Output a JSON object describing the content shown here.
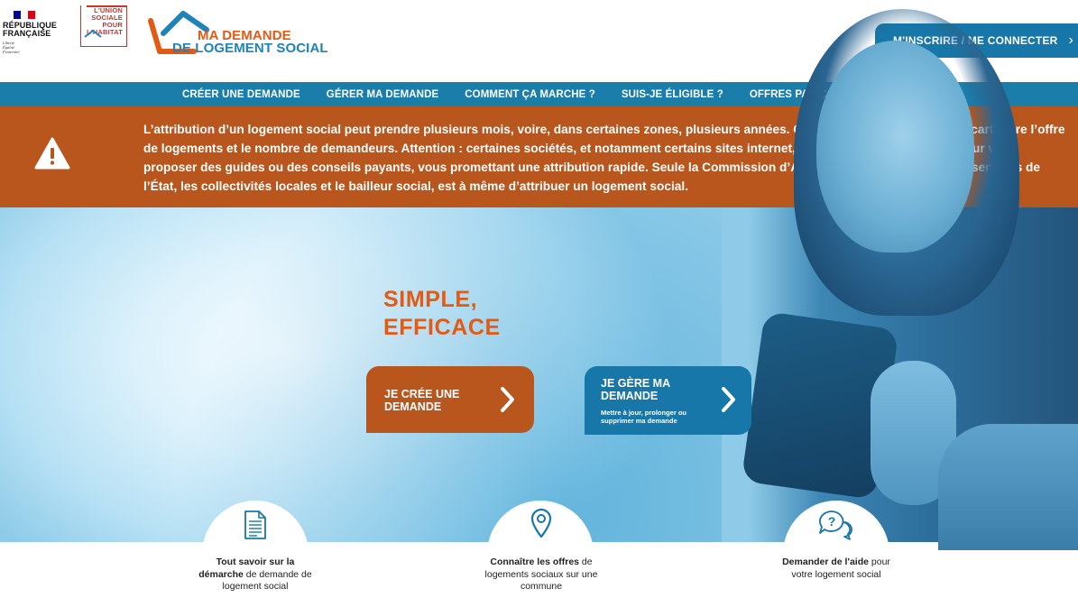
{
  "header": {
    "republique": {
      "line1": "RÉPUBLIQUE",
      "line2": "FRANÇAISE",
      "motto1": "Liberté",
      "motto2": "Égalité",
      "motto3": "Fraternité"
    },
    "union_logo": {
      "line1": "L'UNION",
      "line2": "SOCIALE",
      "line3": "POUR",
      "line4": "L'HABITAT"
    },
    "site_logo": {
      "line1": "MA DEMANDE",
      "line2": "DE LOGEMENT SOCIAL"
    },
    "login_label": "M'INSCRIRE / ME CONNECTER",
    "login_chevron": "›"
  },
  "nav": {
    "items": [
      "CRÉER UNE DEMANDE",
      "GÉRER MA DEMANDE",
      "COMMENT ÇA MARCHE ?",
      "SUIS-JE ÉLIGIBLE ?",
      "OFFRES PAR COMMUNE"
    ]
  },
  "alert": {
    "icon": "warning-icon",
    "text": "L’attribution d’un logement social peut prendre plusieurs mois, voire, dans certaines zones, plusieurs années. Ce temps d’attente est dû à l’écart entre l’offre de logements et le nombre de demandeurs. Attention : certaines sociétés, et notamment certains sites internet, profitent de cette situation pour vous proposer des guides ou des conseils payants, vous promettant une attribution rapide. Seule la Commission d’Attribution, qui réunit les représentants de l’État, les collectivités locales et le bailleur social, est à même d’attribuer un logement social."
  },
  "hero": {
    "title_line1": "SIMPLE,",
    "title_line2": "EFFICACE",
    "create": {
      "line1": "JE CRÉE UNE",
      "line2": "DEMANDE"
    },
    "manage": {
      "line1": "JE GÈRE MA",
      "line2": "DEMANDE",
      "sub1": "Mettre à jour, prolonger ou",
      "sub2": "supprimer ma demande"
    }
  },
  "features": [
    {
      "icon": "document-icon",
      "bold1": "Tout savoir sur la",
      "bold2": "démarche",
      "rest2": " de demande de",
      "rest3": "logement social"
    },
    {
      "icon": "location-pin-icon",
      "bold1": "Connaître les offres",
      "rest1": " de",
      "rest2": "logements sociaux sur une",
      "rest3": "commune"
    },
    {
      "icon": "help-chat-icon",
      "bold1": "Demander de l'aide",
      "rest1": " pour",
      "rest2": "votre logement social"
    }
  ],
  "colors": {
    "brand_blue": "#1b7daa",
    "brand_orange": "#e35b13",
    "alert_brown": "#b8561d"
  }
}
